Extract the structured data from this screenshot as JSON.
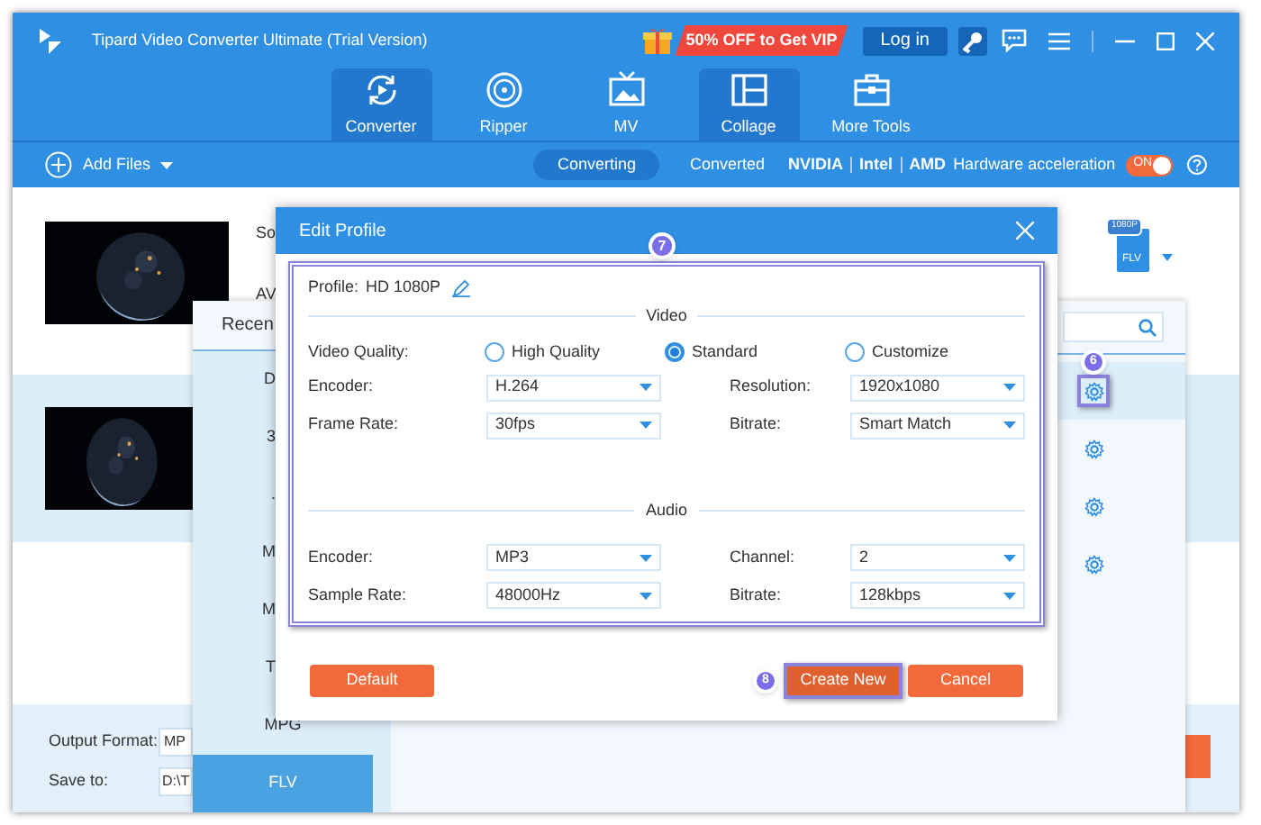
{
  "window": {
    "title": "Tipard Video Converter Ultimate (Trial Version)",
    "promo": "50% OFF to Get VIP",
    "login": "Log in"
  },
  "nav_tabs": [
    {
      "label": "Converter",
      "selected": true
    },
    {
      "label": "Ripper",
      "selected": false
    },
    {
      "label": "MV",
      "selected": false
    },
    {
      "label": "Collage",
      "selected": true
    },
    {
      "label": "More Tools",
      "selected": false
    }
  ],
  "toolbar": {
    "add_files": "Add Files",
    "subtabs": [
      {
        "label": "Converting",
        "selected": true
      },
      {
        "label": "Converted",
        "selected": false
      }
    ],
    "gpus": [
      "NVIDIA",
      "Intel",
      "AMD"
    ],
    "hw_label": "Hardware acceleration",
    "hw_toggle": {
      "label": "ON",
      "on": true
    }
  },
  "files": [
    {
      "source_label": "So",
      "format_label": "AV",
      "selected": false
    },
    {
      "selected": true
    }
  ],
  "output_profile": {
    "badge": "1080P",
    "format": "FLV"
  },
  "bottom": {
    "output_format_label": "Output Format:",
    "output_format_value": "MP",
    "save_to_label": "Save to:",
    "save_to_value": "D:\\T"
  },
  "format_popup": {
    "tab": "Recen",
    "callout": "6",
    "categories": [
      {
        "label": "D",
        "kind": "clipped",
        "selected": false
      },
      {
        "label": "3",
        "kind": "clipped",
        "selected": false
      },
      {
        "label": ".",
        "kind": "clipped",
        "selected": false
      },
      {
        "label": "M",
        "kind": "clipped",
        "selected": false
      },
      {
        "label": "M",
        "kind": "clipped",
        "selected": false
      },
      {
        "label": "T",
        "kind": "clipped",
        "selected": false
      },
      {
        "label": "MPG",
        "kind": "full",
        "selected": false
      },
      {
        "label": "FLV",
        "kind": "full",
        "selected": true
      }
    ],
    "profiles": [
      {
        "selected": true
      },
      {
        "selected": false
      },
      {
        "selected": false
      },
      {
        "selected": false
      }
    ]
  },
  "dialog": {
    "title": "Edit Profile",
    "callout": "7",
    "profile_label": "Profile:",
    "profile_name": "HD 1080P",
    "video": {
      "heading": "Video",
      "quality_label": "Video Quality:",
      "quality_options": [
        {
          "label": "High Quality",
          "selected": false
        },
        {
          "label": "Standard",
          "selected": true
        },
        {
          "label": "Customize",
          "selected": false
        }
      ],
      "rows": [
        {
          "label": "Encoder:",
          "value": "H.264",
          "label_2": "Resolution:",
          "value_2": "1920x1080"
        },
        {
          "label": "Frame Rate:",
          "value": "30fps",
          "label_2": "Bitrate:",
          "value_2": "Smart Match"
        }
      ]
    },
    "audio": {
      "heading": "Audio",
      "rows": [
        {
          "label": "Encoder:",
          "value": "MP3",
          "label_2": "Channel:",
          "value_2": "2"
        },
        {
          "label": "Sample Rate:",
          "value": "48000Hz",
          "label_2": "Bitrate:",
          "value_2": "128kbps"
        }
      ]
    },
    "buttons": {
      "default": "Default",
      "create_new": "Create New",
      "create_new_callout": "8",
      "cancel": "Cancel"
    }
  }
}
